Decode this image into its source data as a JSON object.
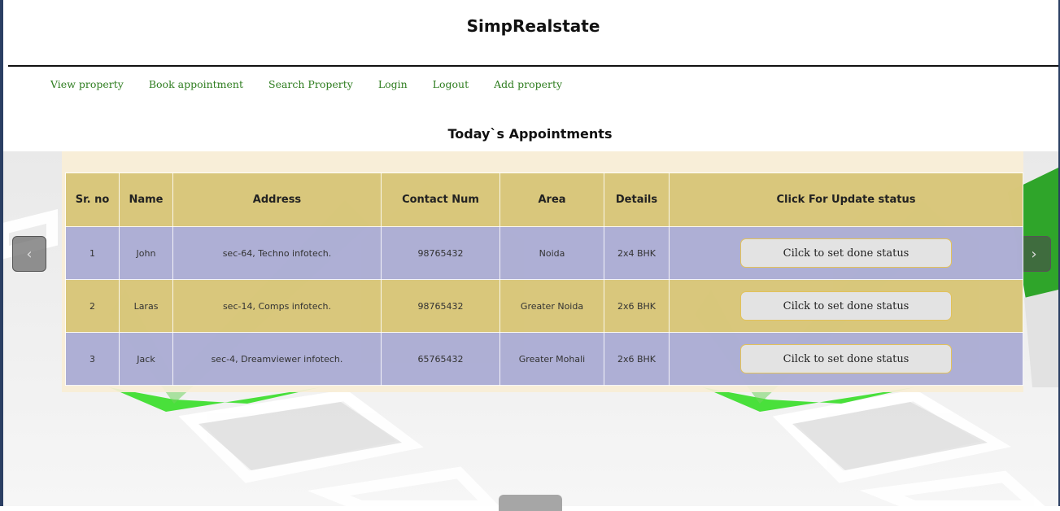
{
  "site": {
    "title": "SimpRealstate"
  },
  "nav": [
    {
      "label": "View property"
    },
    {
      "label": "Book appointment"
    },
    {
      "label": "Search Property"
    },
    {
      "label": "Login"
    },
    {
      "label": "Logout"
    },
    {
      "label": "Add property"
    }
  ],
  "page": {
    "heading": "Today`s Appointments"
  },
  "table": {
    "headers": [
      "Sr. no",
      "Name",
      "Address",
      "Contact Num",
      "Area",
      "Details",
      "Click For Update status"
    ],
    "rows": [
      {
        "sr": "1",
        "name": "John",
        "address": "sec-64, Techno infotech.",
        "contact": "98765432",
        "area": "Noida",
        "details": "2x4 BHK",
        "action": "Cilck to set done status"
      },
      {
        "sr": "2",
        "name": "Laras",
        "address": "sec-14, Comps infotech.",
        "contact": "98765432",
        "area": "Greater Noida",
        "details": "2x6 BHK",
        "action": "Cilck to set done status"
      },
      {
        "sr": "3",
        "name": "Jack",
        "address": "sec-4, Dreamviewer infotech.",
        "contact": "65765432",
        "area": "Greater Mohali",
        "details": "2x6 BHK",
        "action": "Cilck to set done status"
      }
    ]
  },
  "carousel": {
    "prev_icon": "chevron-left-icon",
    "next_icon": "chevron-right-icon",
    "prev_glyph": "‹",
    "next_glyph": "›"
  },
  "colors": {
    "nav_link": "#2e7d1f",
    "header_row": "#d6c474",
    "row_blue": "#a8aad4",
    "button_border": "#e2c15a"
  }
}
